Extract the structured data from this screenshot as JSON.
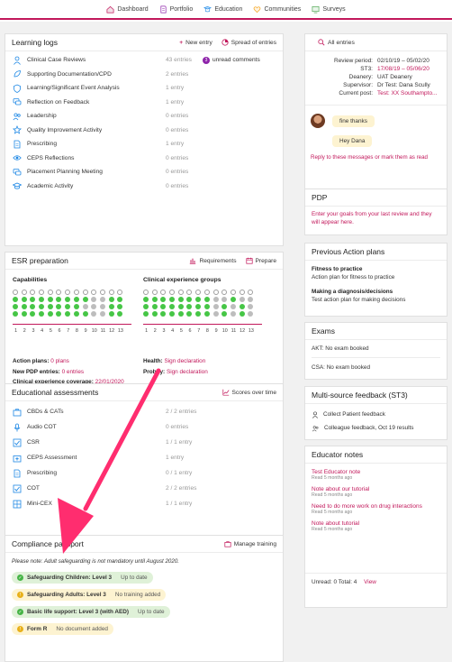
{
  "topnav": {
    "items": [
      {
        "label": "Dashboard",
        "icon": "home-icon"
      },
      {
        "label": "Portfolio",
        "icon": "portfolio-icon"
      },
      {
        "label": "Education",
        "icon": "education-icon"
      },
      {
        "label": "Communities",
        "icon": "heart-icon"
      },
      {
        "label": "Surveys",
        "icon": "survey-icon"
      }
    ]
  },
  "learning_logs": {
    "title": "Learning logs",
    "new_entry": "New entry",
    "spread": "Spread of entries",
    "rows": [
      {
        "label": "Clinical Case Reviews",
        "count": "43 entries",
        "badge": "3",
        "extra": "unread comments"
      },
      {
        "label": "Supporting Documentation/CPD",
        "count": "2 entries"
      },
      {
        "label": "Learning/Significant Event Analysis",
        "count": "1 entry"
      },
      {
        "label": "Reflection on Feedback",
        "count": "1 entry"
      },
      {
        "label": "Leadership",
        "count": "0 entries"
      },
      {
        "label": "Quality Improvement Activity",
        "count": "0 entries"
      },
      {
        "label": "Prescribing",
        "count": "1 entry"
      },
      {
        "label": "CEPS Reflections",
        "count": "0 entries"
      },
      {
        "label": "Placement Planning Meeting",
        "count": "0 entries"
      },
      {
        "label": "Academic Activity",
        "count": "0 entries"
      }
    ]
  },
  "esr": {
    "title": "ESR preparation",
    "requirements": "Requirements",
    "prepare": "Prepare",
    "capabilities": "Capabilities",
    "clinical": "Clinical experience groups",
    "cap_numbers": [
      "1",
      "2",
      "3",
      "4",
      "5",
      "6",
      "7",
      "8",
      "9",
      "10",
      "11",
      "12",
      "13"
    ],
    "clin_numbers": [
      "1",
      "2",
      "3",
      "4",
      "5",
      "6",
      "7",
      "8",
      "9",
      "10",
      "11",
      "12",
      "13"
    ],
    "action_plans_label": "Action plans:",
    "action_plans_value": "0 plans",
    "new_pdp_label": "New PDP entries:",
    "new_pdp_value": "0 entries",
    "coverage_label": "Clinical experience coverage:",
    "coverage_value": "22/01/2020",
    "health_label": "Health:",
    "health_value": "Sign declaration",
    "probity_label": "Probity:",
    "probity_value": "Sign declaration"
  },
  "assessments": {
    "title": "Educational assessments",
    "scores": "Scores over time",
    "rows": [
      {
        "label": "CBDs & CATs",
        "count": "2 / 2 entries"
      },
      {
        "label": "Audio COT",
        "count": "0 entries"
      },
      {
        "label": "CSR",
        "count": "1 / 1 entry"
      },
      {
        "label": "CEPS Assessment",
        "count": "1 entry"
      },
      {
        "label": "Prescribing",
        "count": "0 / 1 entry"
      },
      {
        "label": "COT",
        "count": "2 / 2 entries"
      },
      {
        "label": "Mini-CEX",
        "count": "1 / 1 entry"
      }
    ]
  },
  "compliance": {
    "title": "Compliance passport",
    "manage": "Manage training",
    "note": "Please note: Adult safeguarding is not mandatory until August 2020.",
    "items": [
      {
        "label": "Safeguarding Children: Level 3",
        "status": "Up to date",
        "color": "green"
      },
      {
        "label": "Safeguarding Adults: Level 3",
        "status": "No training added",
        "color": "yellow"
      },
      {
        "label": "Basic life support: Level 3 (with AED)",
        "status": "Up to date",
        "color": "green"
      },
      {
        "label": "Form R",
        "status": "No document added",
        "color": "yellow"
      }
    ]
  },
  "entries": {
    "all_entries": "All entries",
    "fields": [
      {
        "k": "Review period:",
        "v": "02/10/19 – 05/02/20"
      },
      {
        "k": "ST3:",
        "v": "17/08/19 – 05/06/20"
      },
      {
        "k": "Deanery:",
        "v": "UAT Deanery"
      },
      {
        "k": "Supervisor:",
        "v": "Dr Test: Dana Scully"
      },
      {
        "k": "Current post:",
        "v": "Test: XX Southampto..."
      }
    ],
    "messages": [
      "fine thanks",
      "Hey Dana"
    ],
    "reply": "Reply to these messages or mark them as read"
  },
  "pdp": {
    "title": "PDP",
    "text": "Enter your goals from your last review and they will appear here."
  },
  "action_plans": {
    "title": "Previous Action plans",
    "items": [
      {
        "title": "Fitness to practice",
        "sub": "Action plan for fitness to practice"
      },
      {
        "title": "Making a diagnosis/decisions",
        "sub": "Test action plan for making decisions"
      }
    ]
  },
  "exams": {
    "title": "Exams",
    "items": [
      "AKT: No exam booked",
      "CSA: No exam booked"
    ]
  },
  "msf": {
    "title": "Multi-source feedback (ST3)",
    "items": [
      "Collect Patient feedback",
      "Colleague feedback, Oct 19 results"
    ]
  },
  "educator_notes": {
    "title": "Educator notes",
    "notes": [
      {
        "title": "Test Educator note",
        "read": "Read 5 months ago"
      },
      {
        "title": "Note about our tutorial",
        "read": "Read 5 months ago"
      },
      {
        "title": "Need to do more work on drug interactions",
        "read": "Read 5 months ago"
      },
      {
        "title": "Note about tutorial",
        "read": "Read 5 months ago"
      }
    ],
    "footer": "Unread: 0 Total: 4",
    "view": "View"
  },
  "colors": {
    "accent": "#c2185b",
    "arrow": "#ff2d6f",
    "green": "#46c646",
    "badge": "#8e24aa"
  }
}
